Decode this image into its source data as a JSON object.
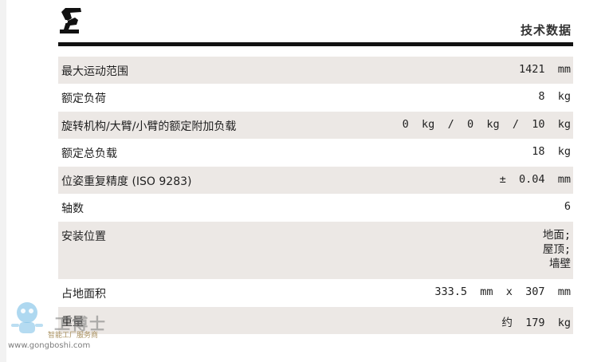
{
  "header": {
    "title": "技术数据"
  },
  "specs": {
    "max_reach": {
      "label": "最大运动范围",
      "value": "1421  mm"
    },
    "rated_payload": {
      "label": "额定负荷",
      "value": "8  kg"
    },
    "additional_payload": {
      "label": "旋转机构/大臂/小臂的额定附加负载",
      "value": "0  kg  /  0  kg  /  10  kg"
    },
    "total_payload": {
      "label": "额定总负载",
      "value": "18  kg"
    },
    "repeatability": {
      "label": "位姿重复精度 (ISO 9283)",
      "value": "±  0.04  mm"
    },
    "axes": {
      "label": "轴数",
      "value": "6"
    },
    "mounting": {
      "label": "安装位置",
      "values": [
        "地面;",
        "屋顶;",
        "墙壁"
      ]
    },
    "footprint": {
      "label": "占地面积",
      "value": "333.5  mm  x  307  mm"
    },
    "weight": {
      "label": "重量",
      "value": "约  179  kg"
    }
  },
  "watermark": {
    "brand": "工博士",
    "tagline": "智能工厂服务商",
    "url": "www.gongboshi.com"
  }
}
